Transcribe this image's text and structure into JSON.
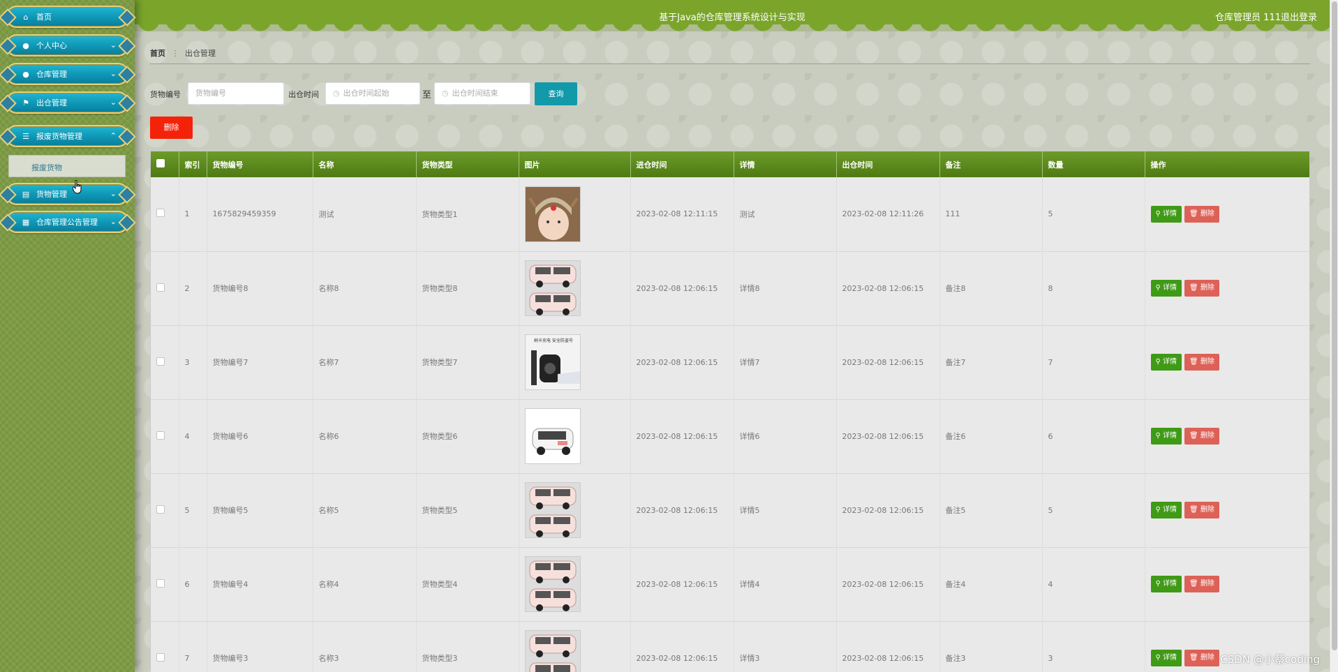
{
  "header": {
    "title": "基于Java的仓库管理系统设计与实现",
    "user": "仓库管理员 111",
    "logout": "退出登录"
  },
  "sidebar": {
    "items": [
      {
        "label": "首页",
        "icon": "home-icon"
      },
      {
        "label": "个人中心",
        "icon": "user-icon"
      },
      {
        "label": "仓库管理",
        "icon": "user-icon"
      },
      {
        "label": "出仓管理",
        "icon": "flag-icon"
      },
      {
        "label": "报废货物管理",
        "icon": "list-icon"
      },
      {
        "label": "货物管理",
        "icon": "clipboard-icon"
      },
      {
        "label": "仓库管理公告管理",
        "icon": "grid-icon"
      }
    ],
    "submenu_label": "报废货物"
  },
  "breadcrumb": {
    "home": "首页",
    "current": "出仓管理"
  },
  "search": {
    "code_label": "货物编号",
    "code_placeholder": "货物编号",
    "time_label": "出仓时间",
    "start_placeholder": "出仓时间起始",
    "to_label": "至",
    "end_placeholder": "出仓时间结束",
    "query_button": "查询"
  },
  "delete_button": "删除",
  "table": {
    "headers": [
      "索引",
      "货物编号",
      "名称",
      "货物类型",
      "图片",
      "进仓时间",
      "详情",
      "出仓时间",
      "备注",
      "数量",
      "操作"
    ],
    "rows": [
      {
        "index": "1",
        "code": "1675829459359",
        "name": "测试",
        "type": "货物类型1",
        "image": "child-photo",
        "in_time": "2023-02-08 12:11:15",
        "detail": "测试",
        "out_time": "2023-02-08 12:11:26",
        "remark": "111",
        "qty": "5"
      },
      {
        "index": "2",
        "code": "货物编号8",
        "name": "名称8",
        "type": "货物类型8",
        "image": "pink-car-photo",
        "in_time": "2023-02-08 12:06:15",
        "detail": "详情8",
        "out_time": "2023-02-08 12:06:15",
        "remark": "备注8",
        "qty": "8"
      },
      {
        "index": "3",
        "code": "货物编号7",
        "name": "名称7",
        "type": "货物类型7",
        "image": "charger-photo",
        "in_time": "2023-02-08 12:06:15",
        "detail": "详情7",
        "out_time": "2023-02-08 12:06:15",
        "remark": "备注7",
        "qty": "7"
      },
      {
        "index": "4",
        "code": "货物编号6",
        "name": "名称6",
        "type": "货物类型6",
        "image": "white-car-photo",
        "in_time": "2023-02-08 12:06:15",
        "detail": "详情6",
        "out_time": "2023-02-08 12:06:15",
        "remark": "备注6",
        "qty": "6"
      },
      {
        "index": "5",
        "code": "货物编号5",
        "name": "名称5",
        "type": "货物类型5",
        "image": "pink-car-photo",
        "in_time": "2023-02-08 12:06:15",
        "detail": "详情5",
        "out_time": "2023-02-08 12:06:15",
        "remark": "备注5",
        "qty": "5"
      },
      {
        "index": "6",
        "code": "货物编号4",
        "name": "名称4",
        "type": "货物类型4",
        "image": "pink-car-photo",
        "in_time": "2023-02-08 12:06:15",
        "detail": "详情4",
        "out_time": "2023-02-08 12:06:15",
        "remark": "备注4",
        "qty": "4"
      },
      {
        "index": "7",
        "code": "货物编号3",
        "name": "名称3",
        "type": "货物类型3",
        "image": "pink-car-photo",
        "in_time": "2023-02-08 12:06:15",
        "detail": "详情3",
        "out_time": "2023-02-08 12:06:15",
        "remark": "备注3",
        "qty": "3"
      }
    ],
    "detail_button": "详情",
    "delete_button": "删除"
  },
  "charger_sign": "刷卡充电 安全防盗号",
  "watermark": "CSDN @小蔡coding",
  "colors": {
    "header": "#7aa52a",
    "menu": "#0d96b5",
    "query": "#1299aa",
    "danger": "#f5220a",
    "detail": "#3f9a16",
    "row_delete": "#dd6157"
  }
}
